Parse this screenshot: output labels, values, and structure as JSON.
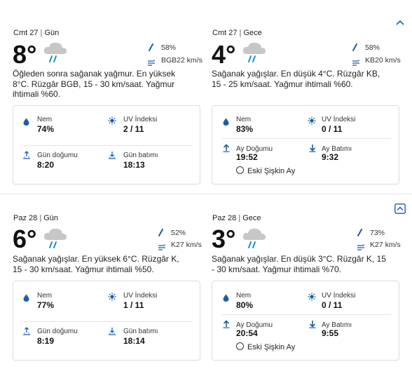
{
  "sections": [
    {
      "left": {
        "date": "Cmt 27",
        "period": "Gün",
        "temp": "8°",
        "precip": "58%",
        "wind": "BGB22 km/s",
        "desc": "Öğleden sonra sağanak yağmur. En yüksek 8°C. Rüzgâr BGB, 15 - 30 km/saat. Yağmur ihtimali %60.",
        "humidity_label": "Nem",
        "humidity": "74%",
        "uv_label": "UV İndeksi",
        "uv": "2 / 11",
        "rise_label": "Gün doğumu",
        "rise": "8:20",
        "set_label": "Gün batımı",
        "set": "18:13"
      },
      "right": {
        "date": "Cmt 27",
        "period": "Gece",
        "temp": "4°",
        "precip": "58%",
        "wind": "KB20 km/s",
        "desc": "Sağanak yağışlar. En düşük 4°C. Rüzgâr KB, 15 - 25 km/saat. Yağmur ihtimali %60.",
        "humidity_label": "Nem",
        "humidity": "83%",
        "uv_label": "UV İndeksi",
        "uv": "0 / 11",
        "rise_label": "Ay Doğumu",
        "rise": "19:52",
        "set_label": "Ay Batımı",
        "set": "9:32",
        "moon_phase": "Eski Şişkin Ay"
      }
    },
    {
      "left": {
        "date": "Paz 28",
        "period": "Gün",
        "temp": "6°",
        "precip": "52%",
        "wind": "K27 km/s",
        "desc": "Sağanak yağışlar. En yüksek 6°C. Rüzgâr K, 15 - 30 km/saat. Yağmur ihtimali %50.",
        "humidity_label": "Nem",
        "humidity": "77%",
        "uv_label": "UV İndeksi",
        "uv": "1 / 11",
        "rise_label": "Gün doğumu",
        "rise": "8:19",
        "set_label": "Gün batımı",
        "set": "18:14"
      },
      "right": {
        "date": "Paz 28",
        "period": "Gece",
        "temp": "3°",
        "precip": "73%",
        "wind": "K27 km/s",
        "desc": "Sağanak yağışlar. En düşük 3°C. Rüzgâr K, 15 - 30 km/saat. Yağmur ihtimali %70.",
        "humidity_label": "Nem",
        "humidity": "80%",
        "uv_label": "UV İndeksi",
        "uv": "0 / 11",
        "rise_label": "Ay Doğumu",
        "rise": "20:54",
        "set_label": "Ay Batımı",
        "set": "9:55",
        "moon_phase": "Eski Şişkin Ay"
      }
    }
  ],
  "separator": "|",
  "colors": {
    "accent": "#1a5dab",
    "icon_blue": "#1a5dab"
  }
}
